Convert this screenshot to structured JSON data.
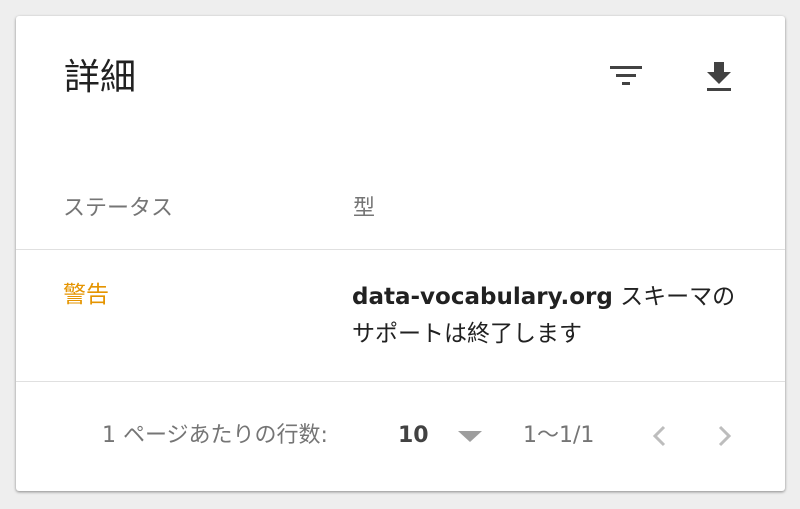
{
  "card": {
    "title": "詳細",
    "icons": {
      "filter": "filter-list-icon",
      "download": "download-icon"
    }
  },
  "table": {
    "columns": [
      "ステータス",
      "型"
    ],
    "rows": [
      {
        "status": "警告",
        "status_color": "#e59400",
        "type_strong": "data-vocabulary.org",
        "type_rest": " スキーマのサポートは終了します"
      }
    ]
  },
  "pagination": {
    "rows_per_page_label": "1 ページあたりの行数:",
    "rows_per_page_value": "10",
    "range": "1〜1/1"
  },
  "colors": {
    "warning": "#e59400",
    "text_primary": "#212121",
    "text_secondary": "#757575",
    "divider": "#e0e0e0"
  }
}
